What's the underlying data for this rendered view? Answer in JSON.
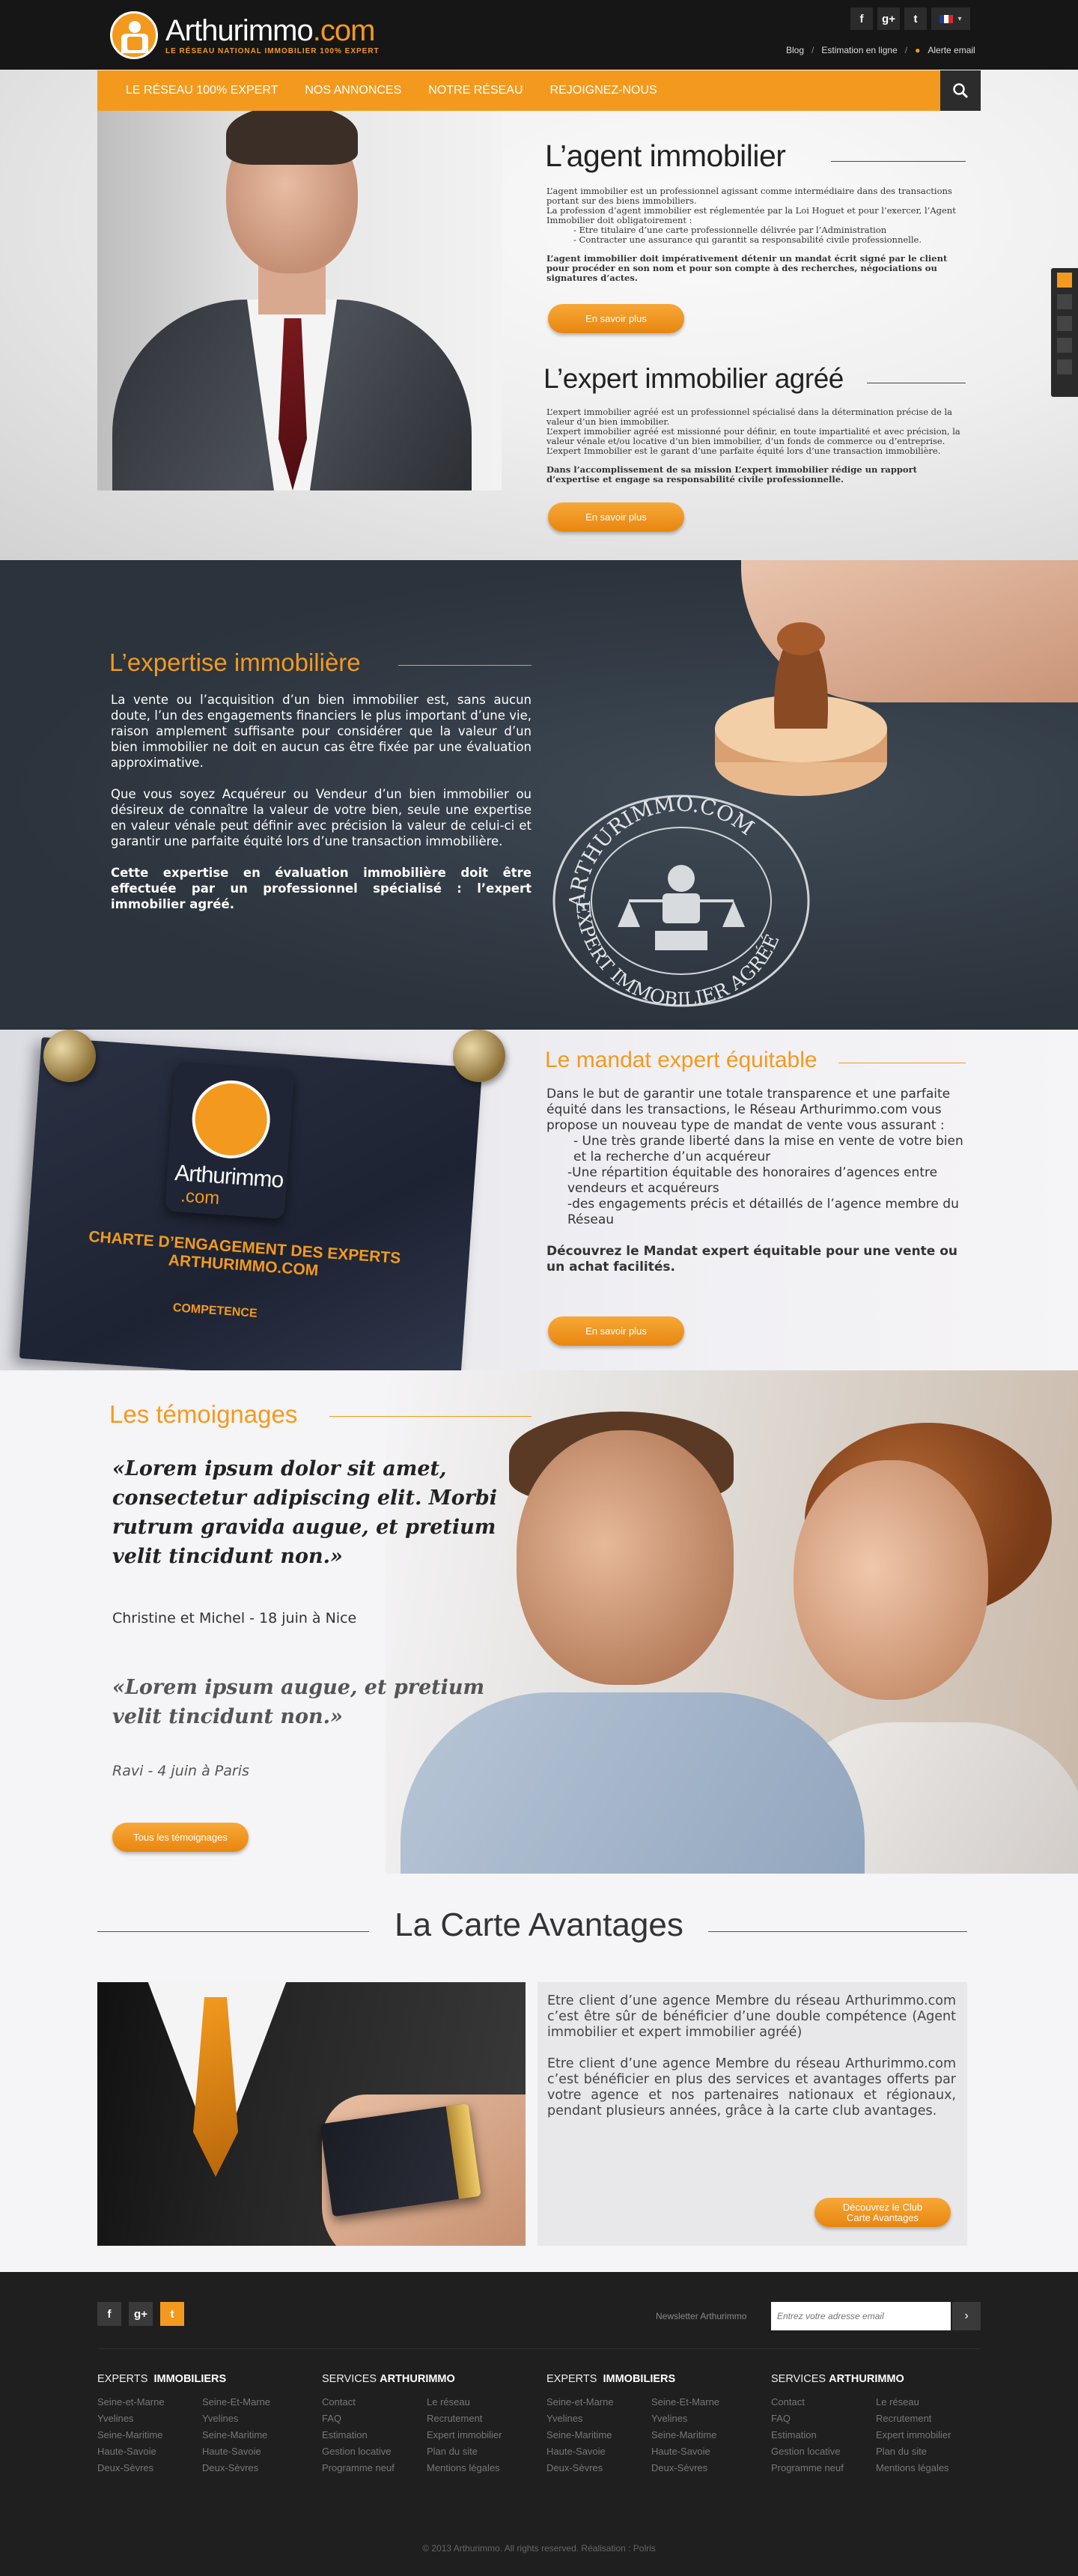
{
  "brand": {
    "name_a": "Arthurimmo",
    "name_b": ".com",
    "tagline": "LE RÉSEAU NATIONAL IMMOBILIER 100% EXPERT",
    "accent": "#f39a1e"
  },
  "topbar": {
    "social": [
      "f",
      "g+",
      "t"
    ],
    "links": [
      "Blog",
      "Estimation en ligne",
      "Alerte email"
    ]
  },
  "nav": {
    "items": [
      "LE RÉSEAU 100% EXPERT",
      "NOS ANNONCES",
      "NOTRE RÉSEAU",
      "REJOIGNEZ-NOUS"
    ],
    "search_icon": "search-icon"
  },
  "hero": {
    "s1": {
      "title": "L’agent immobilier",
      "p1": "L’agent immobilier est un professionnel  agissant comme intermédiaire dans des transactions portant  sur des biens immobiliers.",
      "p2": "La profession d’agent immobilier est réglementée par la Loi Hoguet et pour l’exercer, l’Agent Immobilier doit obligatoirement :",
      "li1": "- Etre titulaire d’une carte professionnelle délivrée par l’Administration",
      "li2": "- Contracter une assurance qui garantit sa responsabilité civile professionnelle.",
      "strong": "L’agent immobilier doit impérativement détenir un mandat écrit signé par le client pour procéder en son nom et pour son compte à des recherches, négociations ou signatures d’actes.",
      "button": "En savoir plus"
    },
    "s2": {
      "title": "L’expert immobilier agréé",
      "p1": "L’expert immobilier agréé est un professionnel spécialisé dans la détermination précise de la valeur d’un bien immobilier.",
      "p2": "L’expert immobilier agréé est missionné  pour définir, en toute impartialité et avec précision, la valeur vénale et/ou locative d’un bien immobilier, d’un fonds de commerce ou d’entreprise.",
      "p3": "L’expert Immobilier est le garant d’une parfaite équité lors d’une transaction immobilière.",
      "strong": "Dans l’accomplissement de sa mission L’expert immobilier rédige un rapport d’expertise et engage sa responsabilité civile professionnelle.",
      "button": "En savoir plus"
    }
  },
  "expertise": {
    "title": "L’expertise immobilière",
    "p1": "La vente ou l’acquisition d’un bien immobilier est, sans aucun doute, l’un des engagements financiers le plus important d’une vie, raison amplement suffisante pour considérer que la valeur d’un bien immobilier ne doit en aucun cas être fixée par une évaluation approximative.",
    "p2": "Que vous soyez Acquéreur ou Vendeur d’un bien immobilier ou désireux de connaître la valeur de votre bien, seule une expertise en valeur vénale peut définir avec précision la valeur de celui-ci et garantir une parfaite équité lors d’une transaction immobilière.",
    "p3": "Cette expertise en évaluation immobilière doit être effectuée par un professionnel spécialisé : l’expert immobilier agréé.",
    "seal_top": "ARTHURIMMO.COM",
    "seal_bottom": "EXPERT IMMOBILIER AGRÉÉ"
  },
  "mandat": {
    "title": "Le mandat expert équitable",
    "intro": "Dans le but de garantir une totale transparence et une parfaite équité dans les transactions, le Réseau Arthurimmo.com vous propose un nouveau type de mandat de vente vous assurant :",
    "li1": "- Une très grande liberté dans la mise en vente de votre bien et la recherche d’un acquéreur",
    "li2": "-Une répartition équitable des honoraires d’agences entre vendeurs et acquéreurs",
    "li3": "-des engagements précis et détaillés de l’agence membre du Réseau",
    "strong": "Découvrez le Mandat expert équitable pour une vente ou un achat facilités.",
    "button": "En savoir plus",
    "board_name_a": "Arthurimmo",
    "board_name_b": ".com",
    "board_title": "CHARTE D’ENGAGEMENT DES EXPERTS ARTHURIMMO.COM",
    "board_sub": "COMPETENCE"
  },
  "temoignages": {
    "title": "Les témoignages",
    "q1": "«Lorem ipsum dolor sit amet, consectetur adipiscing elit. Morbi rutrum gravida augue, et pretium velit tincidunt non.»",
    "a1": "Christine et Michel - 18 juin à Nice",
    "q2": "«Lorem ipsum augue, et pretium velit tincidunt non.»",
    "a2": "Ravi - 4 juin à Paris",
    "button": "Tous les témoignages"
  },
  "carte": {
    "title": "La Carte Avantages",
    "p1": "Etre client d’une agence Membre du réseau Arthurimmo.com c’est être sûr de bénéficier d’une double compétence (Agent immobilier et expert immobilier agréé)",
    "p2": "Etre client d’une agence Membre du réseau Arthurimmo.com  c’est bénéficier en plus des services et avantages offerts par votre agence et nos partenaires nationaux et régionaux, pendant plusieurs années, grâce à la carte club avantages.",
    "button_l1": "Découvrez le Club",
    "button_l2": "Carte Avantages"
  },
  "footer": {
    "social": [
      "f",
      "g+",
      "t"
    ],
    "newsletter_label": "Newsletter Arthurimmo",
    "newsletter_placeholder": "Entrez votre adresse email",
    "newsletter_submit": "›",
    "cols": [
      {
        "h_a": "EXPERTS",
        "h_b": "IMMOBILIERS",
        "l1": [
          "Seine-et-Marne",
          "Yvelines",
          "Seine-Maritime",
          "Haute-Savoie",
          "Deux-Sèvres"
        ],
        "l2": [
          "Seine-Et-Marne",
          "Yvelines",
          "Seine-Maritime",
          "Haute-Savoie",
          "Deux-Sèvres"
        ]
      },
      {
        "h_a": "SERVICES",
        "h_b": "ARTHURIMMO",
        "l1": [
          "Contact",
          "FAQ",
          "Estimation",
          "Gestion locative",
          "Programme neuf"
        ],
        "l2": [
          "Le réseau",
          "Recrutement",
          "Expert immobilier",
          "Plan du site",
          "Mentions légales"
        ]
      },
      {
        "h_a": "EXPERTS",
        "h_b": "IMMOBILIERS",
        "l1": [
          "Seine-et-Marne",
          "Yvelines",
          "Seine-Maritime",
          "Haute-Savoie",
          "Deux-Sèvres"
        ],
        "l2": [
          "Seine-Et-Marne",
          "Yvelines",
          "Seine-Maritime",
          "Haute-Savoie",
          "Deux-Sèvres"
        ]
      },
      {
        "h_a": "SERVICES",
        "h_b": "ARTHURIMMO",
        "l1": [
          "Contact",
          "FAQ",
          "Estimation",
          "Gestion locative",
          "Programme neuf"
        ],
        "l2": [
          "Le réseau",
          "Recrutement",
          "Expert immobilier",
          "Plan du site",
          "Mentions légales"
        ]
      }
    ],
    "copyright": "© 2013 Arthurimmo. All rights reserved. Réalisation : Polris"
  }
}
